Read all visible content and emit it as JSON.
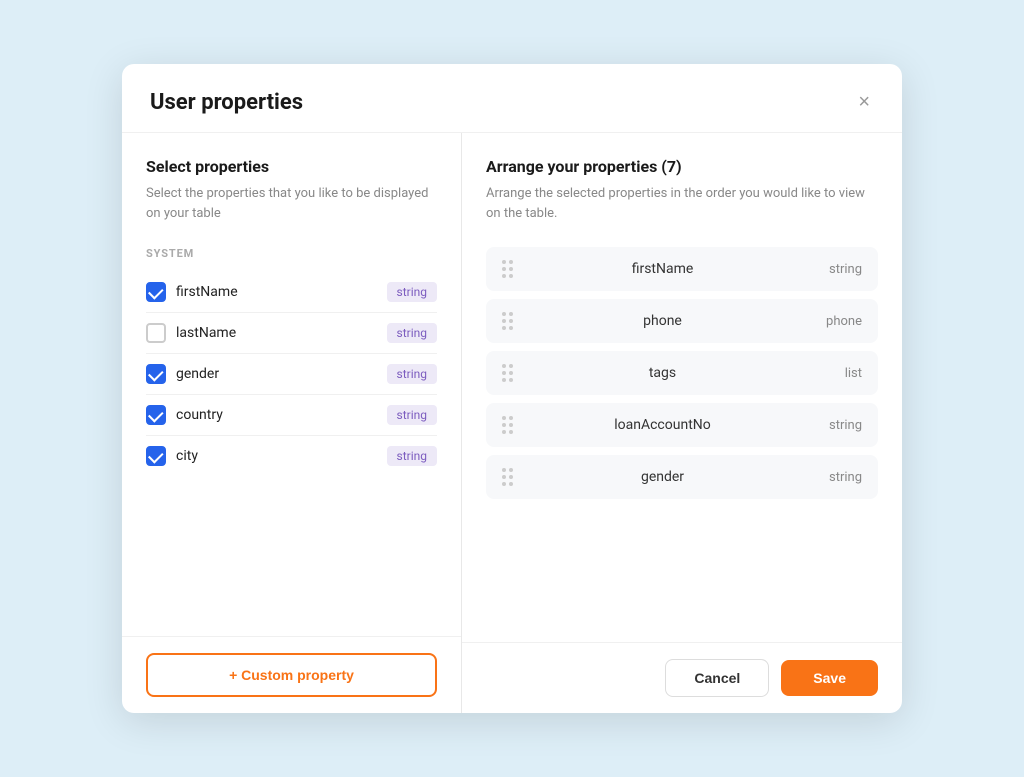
{
  "modal": {
    "title": "User properties",
    "close_label": "×"
  },
  "left_panel": {
    "title": "Select properties",
    "description": "Select the properties that you like to be displayed on your table",
    "section_label": "SYSTEM",
    "properties": [
      {
        "id": "firstName",
        "name": "firstName",
        "type": "string",
        "checked": true
      },
      {
        "id": "lastName",
        "name": "lastName",
        "type": "string",
        "checked": false
      },
      {
        "id": "gender",
        "name": "gender",
        "type": "string",
        "checked": true
      },
      {
        "id": "country",
        "name": "country",
        "type": "string",
        "checked": true
      },
      {
        "id": "city",
        "name": "city",
        "type": "string",
        "checked": true
      }
    ],
    "custom_property_label": "+ Custom property"
  },
  "right_panel": {
    "title": "Arrange your properties (7)",
    "description": "Arrange the selected properties in the order you would like to view on the table.",
    "items": [
      {
        "name": "firstName",
        "type": "string"
      },
      {
        "name": "phone",
        "type": "phone"
      },
      {
        "name": "tags",
        "type": "list"
      },
      {
        "name": "loanAccountNo",
        "type": "string"
      },
      {
        "name": "gender",
        "type": "string"
      }
    ],
    "cancel_label": "Cancel",
    "save_label": "Save"
  }
}
